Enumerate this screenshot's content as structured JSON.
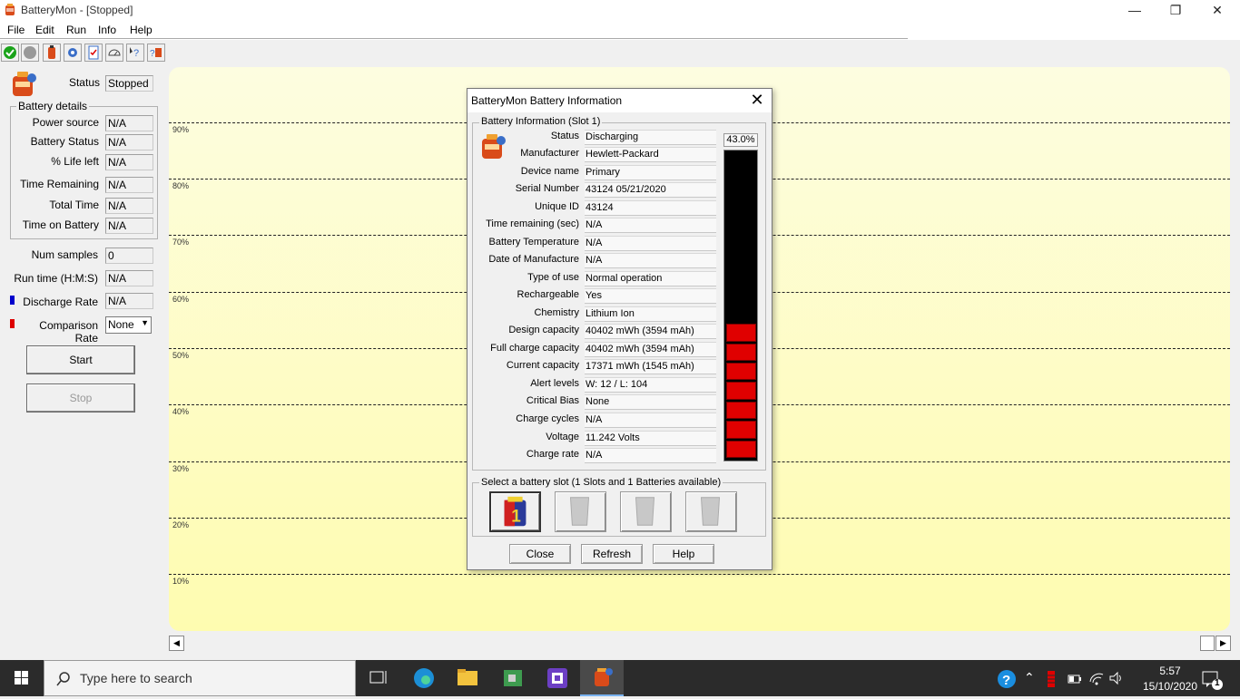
{
  "window": {
    "title": "BatteryMon - [Stopped]"
  },
  "menu": [
    "File",
    "Edit",
    "Run",
    "Info",
    "Help"
  ],
  "left": {
    "status_label": "Status",
    "status_value": "Stopped",
    "group_title": "Battery details",
    "details": [
      {
        "label": "Power source",
        "value": "N/A"
      },
      {
        "label": "Battery Status",
        "value": "N/A"
      },
      {
        "label": "% Life left",
        "value": "N/A"
      },
      {
        "label": "Time Remaining",
        "value": "N/A"
      },
      {
        "label": "Total Time",
        "value": "N/A"
      },
      {
        "label": "Time on Battery",
        "value": "N/A"
      }
    ],
    "num_samples_label": "Num samples",
    "num_samples_value": "0",
    "run_time_label": "Run time (H:M:S)",
    "run_time_value": "N/A",
    "discharge_label": "Discharge Rate",
    "discharge_value": "N/A",
    "comparison_label": "Comparison Rate",
    "comparison_value": "None",
    "start_label": "Start",
    "stop_label": "Stop"
  },
  "chart": {
    "gridlines": [
      "90%",
      "80%",
      "70%",
      "60%",
      "50%",
      "40%",
      "30%",
      "20%",
      "10%"
    ]
  },
  "dialog": {
    "title": "BatteryMon Battery Information",
    "group_title": "Battery Information (Slot 1)",
    "percent": "43.0%",
    "charge_fraction": 0.43,
    "rows": [
      {
        "label": "Status",
        "value": "Discharging"
      },
      {
        "label": "Manufacturer",
        "value": "Hewlett-Packard"
      },
      {
        "label": "Device name",
        "value": "Primary"
      },
      {
        "label": "Serial Number",
        "value": "43124 05/21/2020"
      },
      {
        "label": "Unique ID",
        "value": "43124"
      },
      {
        "label": "Time remaining (sec)",
        "value": "N/A"
      },
      {
        "label": "Battery Temperature",
        "value": "N/A"
      },
      {
        "label": "Date of Manufacture",
        "value": "N/A"
      },
      {
        "label": "Type of use",
        "value": "Normal operation"
      },
      {
        "label": "Rechargeable",
        "value": "Yes"
      },
      {
        "label": "Chemistry",
        "value": "Lithium Ion"
      },
      {
        "label": "Design capacity",
        "value": "40402 mWh (3594 mAh)"
      },
      {
        "label": "Full charge capacity",
        "value": "40402 mWh (3594 mAh)"
      },
      {
        "label": "Current capacity",
        "value": "17371 mWh (1545 mAh)"
      },
      {
        "label": "Alert levels",
        "value": "W: 12 / L: 104"
      },
      {
        "label": "Critical Bias",
        "value": "None"
      },
      {
        "label": "Charge cycles",
        "value": "N/A"
      },
      {
        "label": "Voltage",
        "value": "11.242 Volts"
      },
      {
        "label": "Charge rate",
        "value": "N/A"
      }
    ],
    "slot_group_title": "Select a battery slot (1 Slots and 1 Batteries available)",
    "slot_number": "1",
    "buttons": {
      "close": "Close",
      "refresh": "Refresh",
      "help": "Help"
    }
  },
  "taskbar": {
    "search_placeholder": "Type here to search",
    "time": "5:57",
    "date": "15/10/2020",
    "notification_count": "1"
  },
  "colors": {
    "discharge_marker": "#0000cc",
    "comparison_marker": "#dd0000",
    "gauge_fill": "#e00000"
  }
}
